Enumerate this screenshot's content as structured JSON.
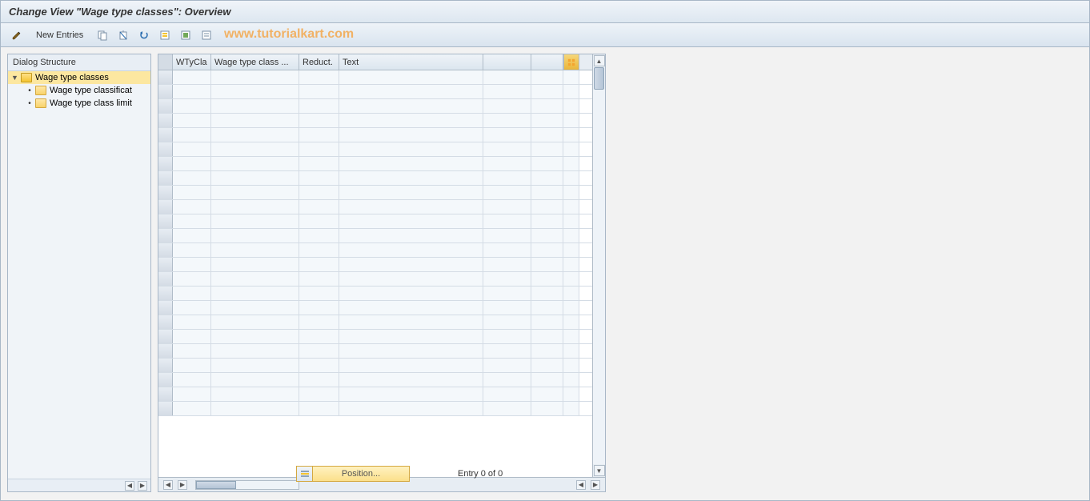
{
  "title": "Change View \"Wage type classes\": Overview",
  "toolbar": {
    "new_entries_label": "New Entries"
  },
  "watermark": "www.tutorialkart.com",
  "tree": {
    "header": "Dialog Structure",
    "root": {
      "label": "Wage type classes"
    },
    "children": [
      {
        "label": "Wage type classificat"
      },
      {
        "label": "Wage type class limit"
      }
    ]
  },
  "table": {
    "columns": {
      "wtycla": "WTyCla",
      "wtclass": "Wage type class ...",
      "reduct": "Reduct.",
      "text": "Text"
    },
    "row_count": 24
  },
  "footer": {
    "position_label": "Position...",
    "entry_text": "Entry 0 of 0"
  }
}
